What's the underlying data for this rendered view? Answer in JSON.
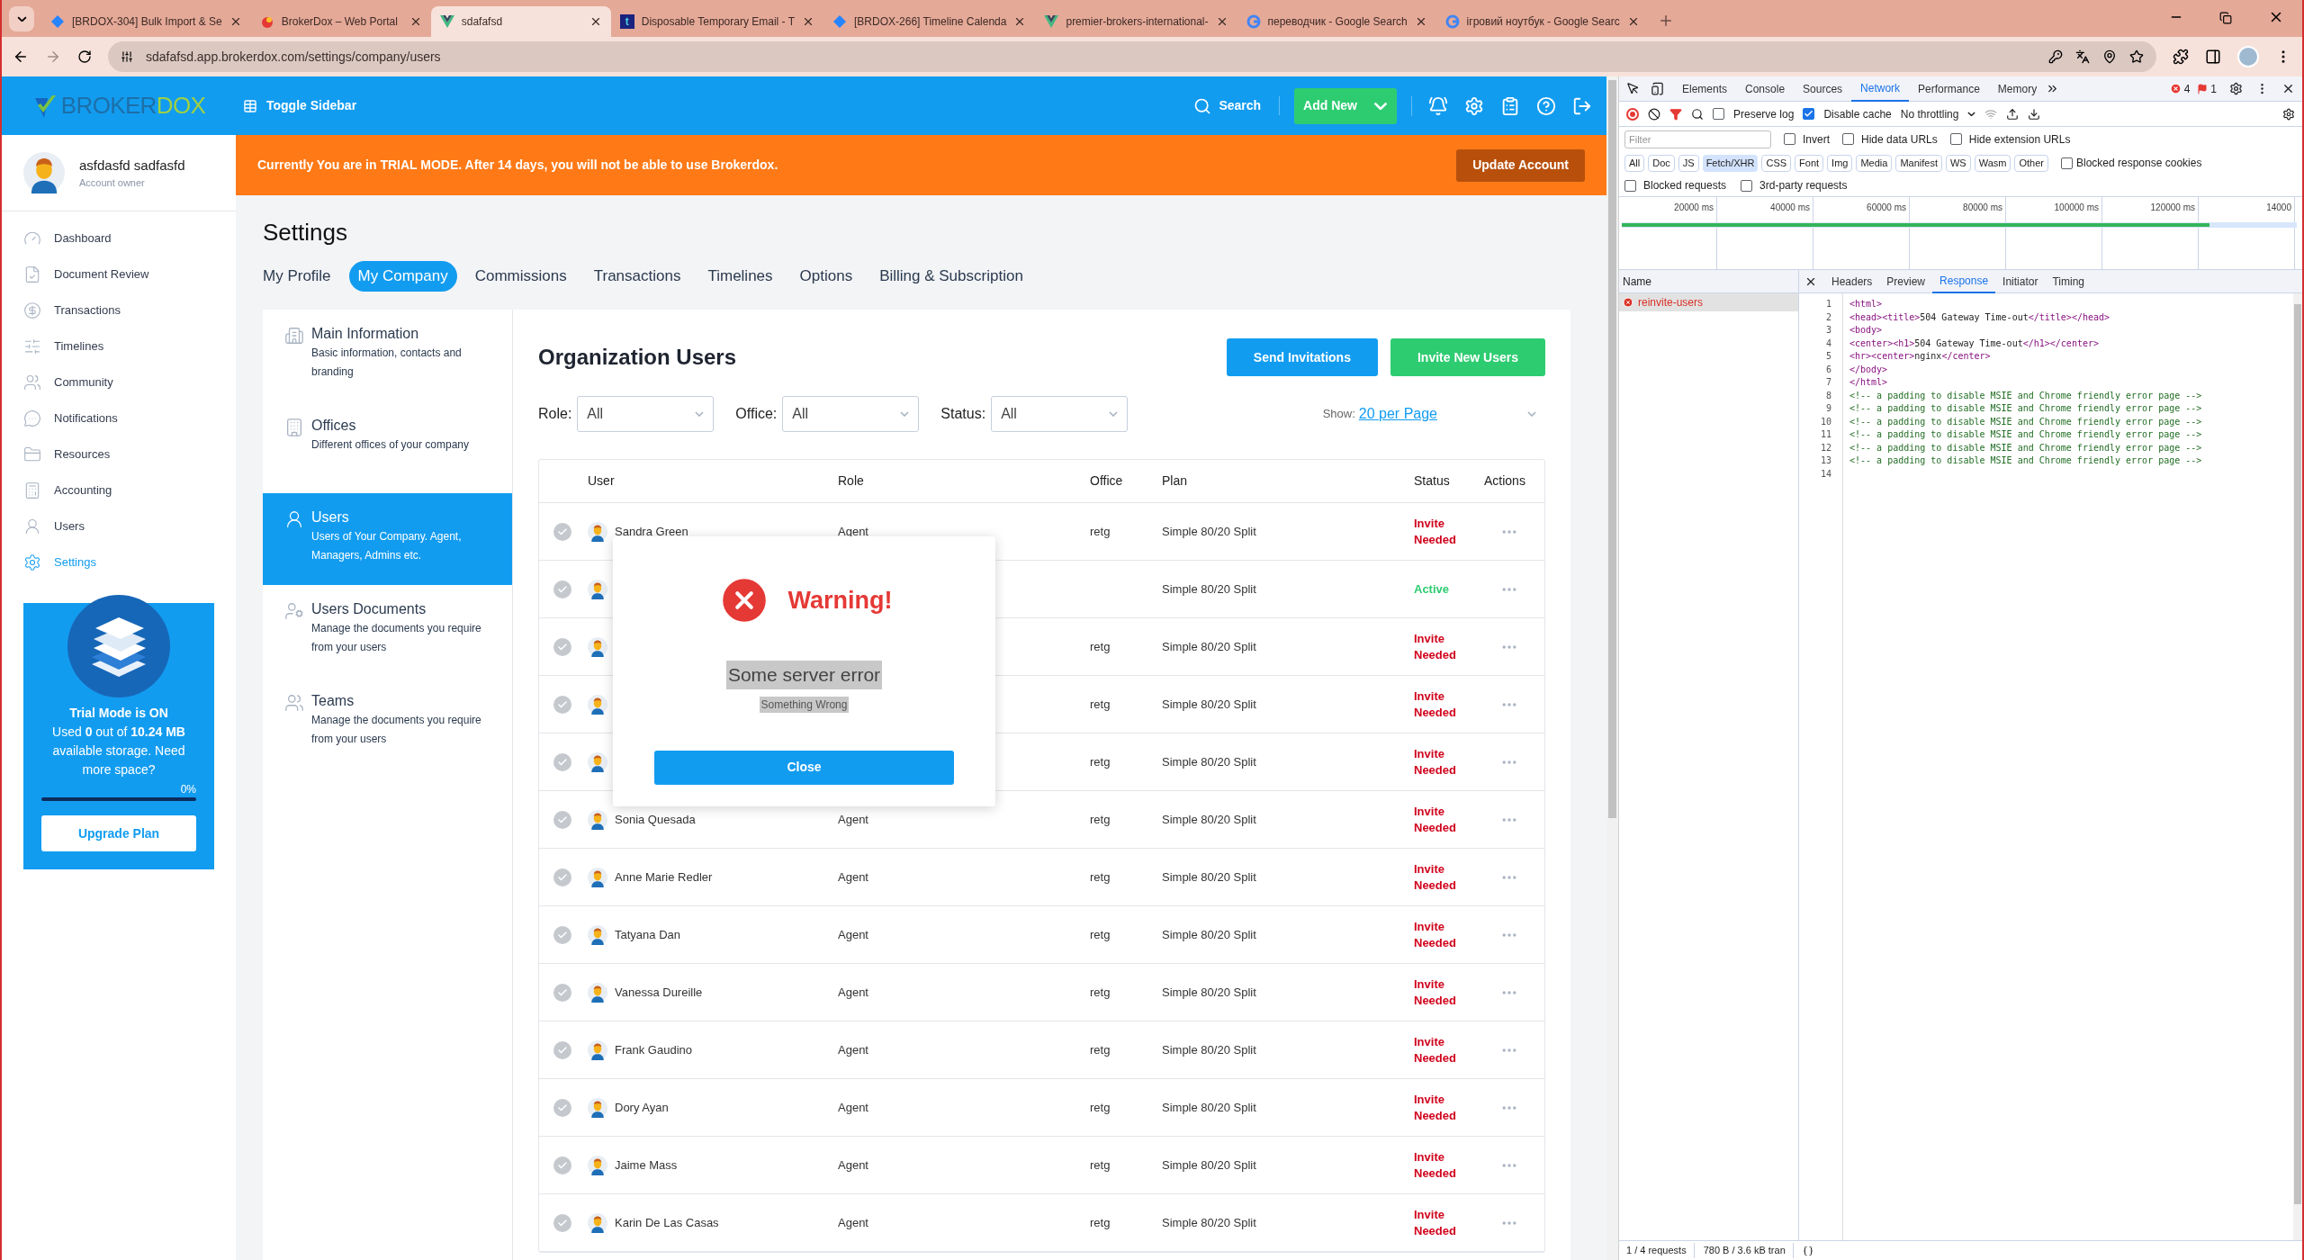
{
  "browser": {
    "tabs": [
      {
        "title": "[BRDOX-304] Bulk Import & Se",
        "selected": false,
        "kind": "diamond"
      },
      {
        "title": "BrokerDox – Web Portal",
        "selected": false,
        "kind": "brokerdox"
      },
      {
        "title": "sdafafsd",
        "selected": true,
        "kind": "vue"
      },
      {
        "title": "Disposable Temporary Email - T",
        "selected": false,
        "kind": "letter"
      },
      {
        "title": "[BRDOX-266] Timeline Calenda",
        "selected": false,
        "kind": "diamond"
      },
      {
        "title": "premier-brokers-international-",
        "selected": false,
        "kind": "vue"
      },
      {
        "title": "переводчик - Google Search",
        "selected": false,
        "kind": "google"
      },
      {
        "title": "ігровий ноутбук - Google Searc",
        "selected": false,
        "kind": "google"
      }
    ],
    "favicon_letter": "t",
    "url": "sdafafsd.app.brokerdox.com/settings/company/users"
  },
  "header": {
    "logo": {
      "first": "BROKER",
      "second": "DOX"
    },
    "toggle_sidebar": "Toggle Sidebar",
    "search": "Search",
    "add_new": "Add New"
  },
  "user": {
    "name": "asfdasfd sadfasfd",
    "role": "Account owner"
  },
  "sidebar": {
    "items": [
      {
        "label": "Dashboard",
        "selected": false
      },
      {
        "label": "Document Review",
        "selected": false
      },
      {
        "label": "Transactions",
        "selected": false
      },
      {
        "label": "Timelines",
        "selected": false
      },
      {
        "label": "Community",
        "selected": false
      },
      {
        "label": "Notifications",
        "selected": false
      },
      {
        "label": "Resources",
        "selected": false
      },
      {
        "label": "Accounting",
        "selected": false
      },
      {
        "label": "Users",
        "selected": false
      },
      {
        "label": "Settings",
        "selected": true
      }
    ]
  },
  "trial_card": {
    "title": "Trial Mode is ON",
    "text": "Used **0** out of **10.24 MB** available storage. Need more space?",
    "percent": "0%",
    "level": 0,
    "button": "Upgrade Plan"
  },
  "banner": {
    "text": "Currently You are in TRIAL MODE. After 14 days, you will not be able to use Brokerdox.",
    "button": "Update Account"
  },
  "settings": {
    "title": "Settings",
    "tabs": [
      {
        "label": "My Profile",
        "selected": false
      },
      {
        "label": "My Company",
        "selected": true
      },
      {
        "label": "Commissions",
        "selected": false
      },
      {
        "label": "Transactions",
        "selected": false
      },
      {
        "label": "Timelines",
        "selected": false
      },
      {
        "label": "Options",
        "selected": false
      },
      {
        "label": "Billing & Subscription",
        "selected": false
      }
    ],
    "menu": [
      {
        "title": "Main Information",
        "description": "Basic information, contacts and branding",
        "selected": false
      },
      {
        "title": "Offices",
        "description": "Different offices of your company",
        "selected": false
      },
      {
        "title": "Users",
        "description": "Users of Your Company. Agent, Managers, Admins etc.",
        "selected": true
      },
      {
        "title": "Users Documents",
        "description": "Manage the documents you require from your users",
        "selected": false
      },
      {
        "title": "Teams",
        "description": "Manage the documents you require from your users",
        "selected": false
      }
    ]
  },
  "users_panel": {
    "title": "Organization Users",
    "buttons": [
      {
        "label": "Send Invitations",
        "kind": "primary"
      },
      {
        "label": "Invite New Users",
        "kind": "success"
      }
    ],
    "filters": [
      {
        "label": "Role:",
        "value": "All"
      },
      {
        "label": "Office:",
        "value": "All"
      },
      {
        "label": "Status:",
        "value": "All"
      }
    ],
    "show_label": "Show:",
    "page_size": "20 per Page",
    "table": {
      "columns": [
        "User",
        "Role",
        "Office",
        "Plan",
        "Status",
        "Actions"
      ],
      "rows": [
        {
          "name": "Sandra Green",
          "role": "Agent",
          "office": "retg",
          "plan": "Simple 80/20 Split",
          "status": "Invite Needed",
          "kind": "invite"
        },
        {
          "plan": "Simple 80/20 Split",
          "status": "Active",
          "kind": "active"
        },
        {
          "office": "retg",
          "plan": "Simple 80/20 Split",
          "status": "Invite Needed",
          "kind": "invite"
        },
        {
          "office": "retg",
          "plan": "Simple 80/20 Split",
          "status": "Invite Needed",
          "kind": "invite"
        },
        {
          "office": "retg",
          "plan": "Simple 80/20 Split",
          "status": "Invite Needed",
          "kind": "invite"
        },
        {
          "name": "Sonia Quesada",
          "role": "Agent",
          "office": "retg",
          "plan": "Simple 80/20 Split",
          "status": "Invite Needed",
          "kind": "invite"
        },
        {
          "name": "Anne Marie Redler",
          "role": "Agent",
          "office": "retg",
          "plan": "Simple 80/20 Split",
          "status": "Invite Needed",
          "kind": "invite"
        },
        {
          "name": "Tatyana Dan",
          "role": "Agent",
          "office": "retg",
          "plan": "Simple 80/20 Split",
          "status": "Invite Needed",
          "kind": "invite"
        },
        {
          "name": "Vanessa Dureille",
          "role": "Agent",
          "office": "retg",
          "plan": "Simple 80/20 Split",
          "status": "Invite Needed",
          "kind": "invite"
        },
        {
          "name": "Frank Gaudino",
          "role": "Agent",
          "office": "retg",
          "plan": "Simple 80/20 Split",
          "status": "Invite Needed",
          "kind": "invite"
        },
        {
          "name": "Dory Ayan",
          "role": "Agent",
          "office": "retg",
          "plan": "Simple 80/20 Split",
          "status": "Invite Needed",
          "kind": "invite"
        },
        {
          "name": "Jaime Mass",
          "role": "Agent",
          "office": "retg",
          "plan": "Simple 80/20 Split",
          "status": "Invite Needed",
          "kind": "invite"
        },
        {
          "name": "Karin De Las Casas",
          "role": "Agent",
          "office": "retg",
          "plan": "Simple 80/20 Split",
          "status": "Invite Needed",
          "kind": "invite"
        }
      ]
    }
  },
  "dialog": {
    "title": "Warning!",
    "message": "Some server error",
    "detail": "Something Wrong",
    "button": "Close"
  },
  "devtools": {
    "tabs": [
      {
        "label": "Elements",
        "selected": false
      },
      {
        "label": "Console",
        "selected": false
      },
      {
        "label": "Sources",
        "selected": false
      },
      {
        "label": "Network",
        "selected": true
      },
      {
        "label": "Performance",
        "selected": false
      },
      {
        "label": "Memory",
        "selected": false
      }
    ],
    "error_count": "4",
    "issue_count": "1",
    "preserve_log": {
      "label": "Preserve log",
      "checked": false
    },
    "disable_cache": {
      "label": "Disable cache",
      "checked": true
    },
    "throttling": "No throttling",
    "filter": {
      "placeholder": "Filter"
    },
    "filter_checks": [
      {
        "label": "Invert",
        "checked": false
      },
      {
        "label": "Hide data URLs",
        "checked": false
      },
      {
        "label": "Hide extension URLs",
        "checked": false
      }
    ],
    "type_chips": [
      {
        "label": "All",
        "selected": false
      },
      {
        "label": "Doc",
        "selected": false
      },
      {
        "label": "JS",
        "selected": false
      },
      {
        "label": "Fetch/XHR",
        "selected": true
      },
      {
        "label": "CSS",
        "selected": false
      },
      {
        "label": "Font",
        "selected": false
      },
      {
        "label": "Img",
        "selected": false
      },
      {
        "label": "Media",
        "selected": false
      },
      {
        "label": "Manifest",
        "selected": false
      },
      {
        "label": "WS",
        "selected": false
      },
      {
        "label": "Wasm",
        "selected": false
      },
      {
        "label": "Other",
        "selected": false
      }
    ],
    "blocked_cookies": {
      "label": "Blocked response cookies",
      "checked": false
    },
    "more_checks": [
      {
        "label": "Blocked requests",
        "checked": false
      },
      {
        "label": "3rd-party requests",
        "checked": false
      }
    ],
    "timeline_ticks": [
      "20000 ms",
      "40000 ms",
      "60000 ms",
      "80000 ms",
      "100000 ms",
      "120000 ms",
      "14000"
    ],
    "name_header": "Name",
    "requests": [
      {
        "name": "reinvite-users",
        "failed": true,
        "selected": true
      }
    ],
    "detail_tabs": [
      {
        "label": "Headers",
        "selected": false
      },
      {
        "label": "Preview",
        "selected": false
      },
      {
        "label": "Response",
        "selected": true
      },
      {
        "label": "Initiator",
        "selected": false
      },
      {
        "label": "Timing",
        "selected": false
      }
    ],
    "response_lines": [
      {
        "number": "1",
        "text": "<html>",
        "kind": "markup"
      },
      {
        "number": "2",
        "text": "<head><title>504 Gateway Time-out</title></head>",
        "kind": "markup"
      },
      {
        "number": "3",
        "text": "<body>",
        "kind": "markup"
      },
      {
        "number": "4",
        "text": "<center><h1>504 Gateway Time-out</h1></center>",
        "kind": "markup"
      },
      {
        "number": "5",
        "text": "<hr><center>nginx</center>",
        "kind": "markup"
      },
      {
        "number": "6",
        "text": "</body>",
        "kind": "markup"
      },
      {
        "number": "7",
        "text": "</html>",
        "kind": "markup"
      },
      {
        "number": "8",
        "text": "<!-- a padding to disable MSIE and Chrome friendly error page -->",
        "kind": "comment"
      },
      {
        "number": "9",
        "text": "<!-- a padding to disable MSIE and Chrome friendly error page -->",
        "kind": "comment"
      },
      {
        "number": "10",
        "text": "<!-- a padding to disable MSIE and Chrome friendly error page -->",
        "kind": "comment"
      },
      {
        "number": "11",
        "text": "<!-- a padding to disable MSIE and Chrome friendly error page -->",
        "kind": "comment"
      },
      {
        "number": "12",
        "text": "<!-- a padding to disable MSIE and Chrome friendly error page -->",
        "kind": "comment"
      },
      {
        "number": "13",
        "text": "<!-- a padding to disable MSIE and Chrome friendly error page -->",
        "kind": "comment"
      },
      {
        "number": "14"
      }
    ],
    "status_bar": {
      "requests": "1 / 4 requests",
      "transferred": "780 B / 3.6 kB tran"
    }
  }
}
